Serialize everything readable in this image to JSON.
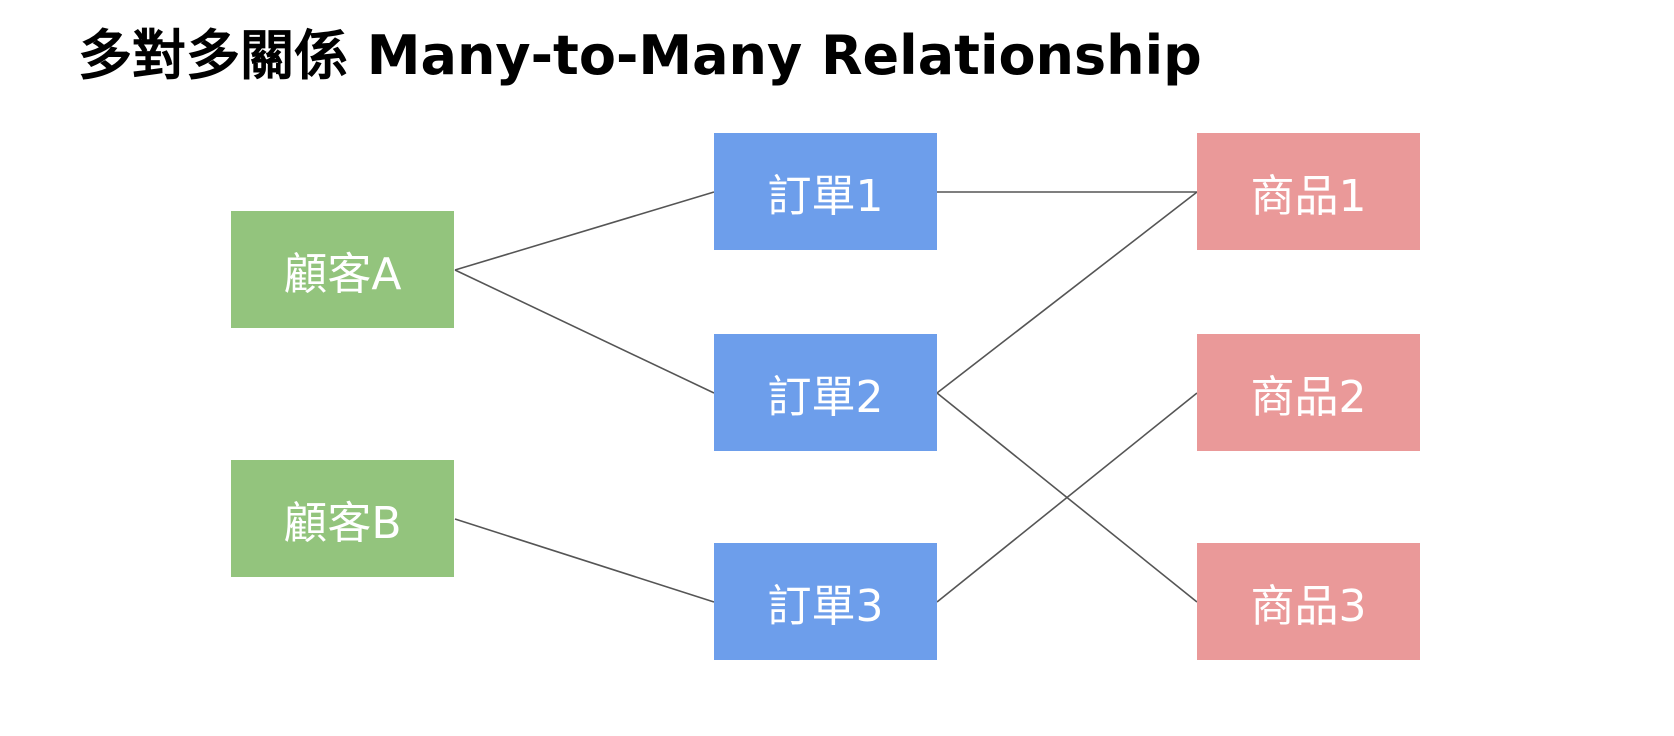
{
  "title": "多對多關係 Many-to-Many Relationship",
  "colors": {
    "customer": "#93c47d",
    "order": "#6d9eeb",
    "product": "#ea9999",
    "connector": "#555555"
  },
  "customers": [
    {
      "id": "A",
      "label": "顧客A"
    },
    {
      "id": "B",
      "label": "顧客B"
    }
  ],
  "orders": [
    {
      "id": "1",
      "label": "訂單1"
    },
    {
      "id": "2",
      "label": "訂單2"
    },
    {
      "id": "3",
      "label": "訂單3"
    }
  ],
  "products": [
    {
      "id": "1",
      "label": "商品1"
    },
    {
      "id": "2",
      "label": "商品2"
    },
    {
      "id": "3",
      "label": "商品3"
    }
  ],
  "links": [
    {
      "from": "customer-A",
      "to": "order-1"
    },
    {
      "from": "customer-A",
      "to": "order-2"
    },
    {
      "from": "customer-B",
      "to": "order-3"
    },
    {
      "from": "order-1",
      "to": "product-1"
    },
    {
      "from": "order-2",
      "to": "product-1"
    },
    {
      "from": "order-2",
      "to": "product-3"
    },
    {
      "from": "order-3",
      "to": "product-2"
    }
  ]
}
